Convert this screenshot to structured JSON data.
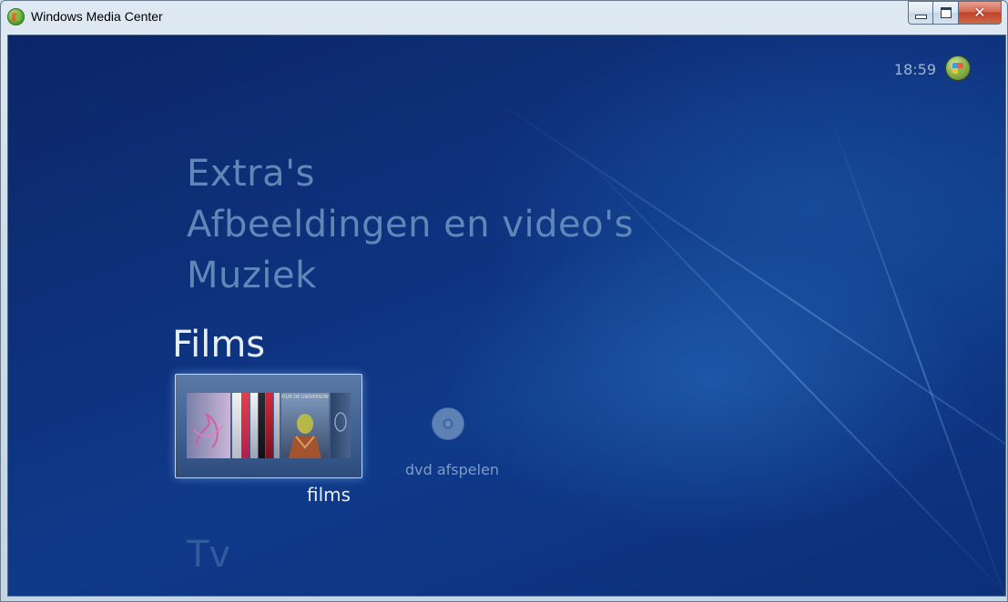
{
  "window": {
    "title": "Windows Media Center",
    "controls": {
      "minimize": "",
      "maximize": "",
      "close": "✕"
    }
  },
  "header": {
    "clock": "18:59"
  },
  "menu": {
    "items_above": [
      "Extra's",
      "Afbeeldingen en video's",
      "Muziek"
    ],
    "active_category": "Films",
    "item_below": "Tv"
  },
  "films_row": {
    "selected_tile_label": "films",
    "secondary_action_label": "dvd afspelen"
  },
  "covers": [
    "FILM DE UNIVERSON"
  ],
  "colors": {
    "background_deep": "#0c2668",
    "background_glow": "#2a6ebe",
    "menu_inactive": "#5f88b8",
    "menu_active": "#e8eef7"
  }
}
